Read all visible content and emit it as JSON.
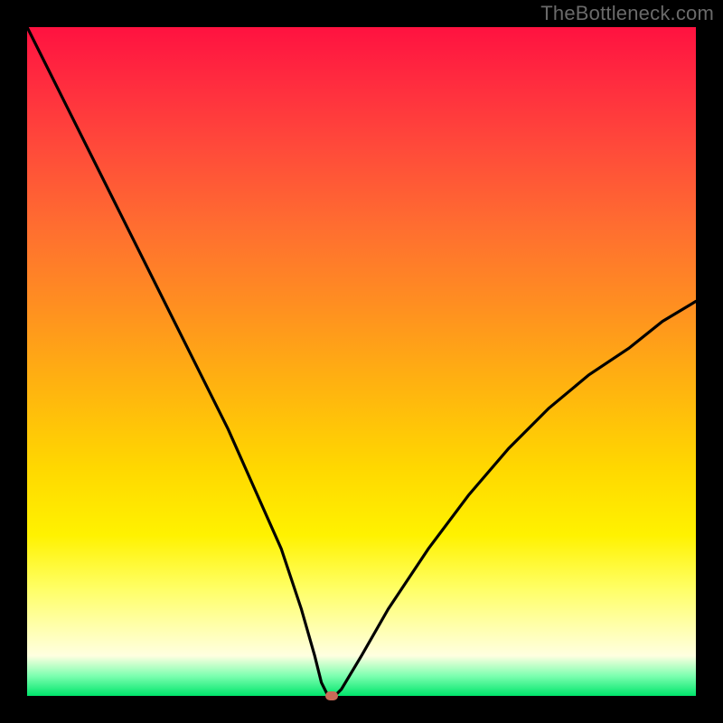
{
  "watermark": "TheBottleneck.com",
  "colors": {
    "frame": "#000000",
    "curve": "#000000",
    "marker": "#c96a58",
    "gradient_top": "#ff1240",
    "gradient_bottom": "#00e56b"
  },
  "chart_data": {
    "type": "line",
    "title": "",
    "xlabel": "",
    "ylabel": "",
    "xlim": [
      0,
      100
    ],
    "ylim": [
      0,
      100
    ],
    "series": [
      {
        "name": "bottleneck-curve",
        "x": [
          0,
          3,
          6,
          10,
          14,
          18,
          22,
          26,
          30,
          34,
          38,
          41,
          43,
          44,
          45,
          46,
          47,
          50,
          54,
          60,
          66,
          72,
          78,
          84,
          90,
          95,
          100
        ],
        "values": [
          100,
          94,
          88,
          80,
          72,
          64,
          56,
          48,
          40,
          31,
          22,
          13,
          6,
          2,
          0,
          0,
          1,
          6,
          13,
          22,
          30,
          37,
          43,
          48,
          52,
          56,
          59
        ]
      }
    ],
    "min_point": {
      "x": 45.5,
      "y": 0
    },
    "grid": false,
    "legend": false
  }
}
